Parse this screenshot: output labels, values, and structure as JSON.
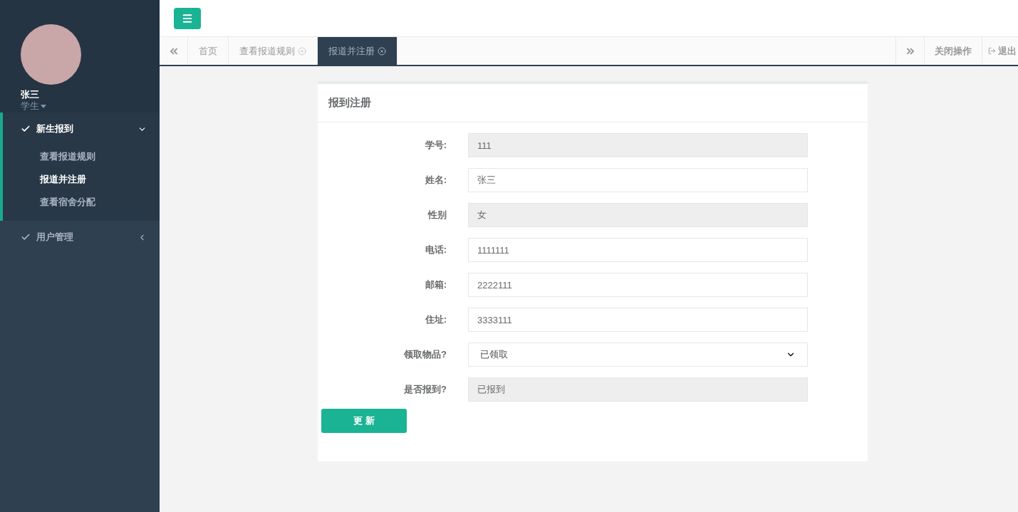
{
  "sidebar": {
    "user": {
      "name": "张三",
      "role": "学生"
    },
    "menu": [
      {
        "label": "新生报到",
        "expanded": true,
        "children": [
          {
            "label": "查看报道规则",
            "selected": false
          },
          {
            "label": "报道并注册",
            "selected": true
          },
          {
            "label": "查看宿舍分配",
            "selected": false
          }
        ]
      },
      {
        "label": "用户管理",
        "expanded": false
      }
    ]
  },
  "tabs": [
    {
      "label": "首页",
      "closable": false,
      "selected": false
    },
    {
      "label": "查看报道规则",
      "closable": true,
      "selected": false
    },
    {
      "label": "报道并注册",
      "closable": true,
      "selected": true
    }
  ],
  "tab_actions": {
    "close": "关闭操作",
    "logout": "退出"
  },
  "form": {
    "title": "报到注册",
    "fields": [
      {
        "label": "学号:",
        "kind": "text",
        "value": "111",
        "disabled": true
      },
      {
        "label": "姓名:",
        "kind": "text",
        "value": "张三",
        "disabled": false
      },
      {
        "label": "性别",
        "kind": "text",
        "value": "女",
        "disabled": true
      },
      {
        "label": "电话:",
        "kind": "text",
        "value": "1111111",
        "disabled": false
      },
      {
        "label": "邮箱:",
        "kind": "text",
        "value": "2222111",
        "disabled": false
      },
      {
        "label": "住址:",
        "kind": "text",
        "value": "3333111",
        "disabled": false
      },
      {
        "label": "领取物品?",
        "kind": "select",
        "value": "已领取",
        "disabled": false
      },
      {
        "label": "是否报到?",
        "kind": "text",
        "value": "已报到",
        "disabled": true
      }
    ],
    "submit": "更 新"
  }
}
